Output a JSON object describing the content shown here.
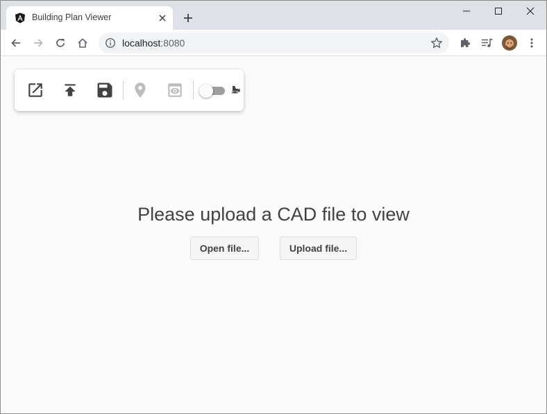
{
  "browser": {
    "tab": {
      "title": "Building Plan Viewer"
    },
    "address": {
      "host": "localhost",
      "port": ":8080"
    }
  },
  "app": {
    "prompt": "Please upload a CAD file to view",
    "open_file_label": "Open file...",
    "upload_file_label": "Upload file..."
  },
  "colors": {
    "tabstrip": "#dee1e6",
    "page_background": "#fafafa",
    "icon_active": "#424242",
    "icon_disabled": "#bdbdbd",
    "favicon": "#1a1a1a"
  },
  "icons": {
    "toolbar": [
      "open-in-new-icon",
      "upload-icon",
      "save-icon",
      "location-pin-icon",
      "preview-icon",
      "bulldozer-icon"
    ],
    "browser": [
      "angular-favicon",
      "close-icon",
      "plus-icon",
      "minimize-icon",
      "maximize-icon",
      "back-arrow-icon",
      "forward-arrow-icon",
      "reload-icon",
      "home-icon",
      "info-icon",
      "star-icon",
      "puzzle-icon",
      "media-queue-icon",
      "kebab-menu-icon"
    ]
  }
}
